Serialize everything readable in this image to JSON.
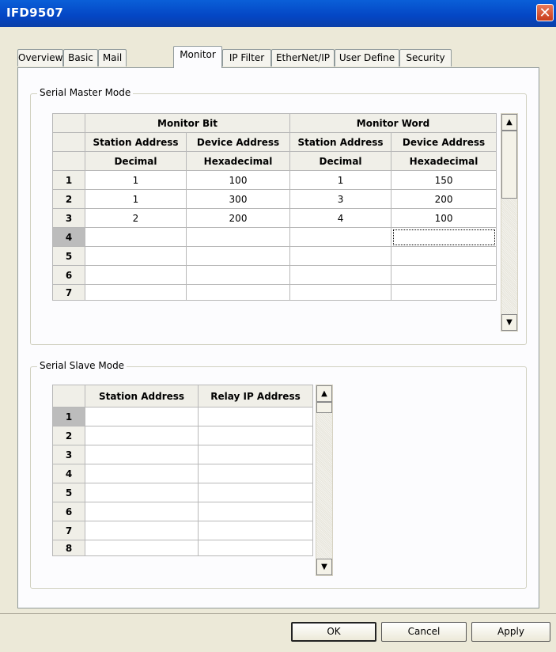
{
  "window": {
    "title": "IFD9507",
    "close_glyph": "✕"
  },
  "tabs": [
    {
      "label": "Overview"
    },
    {
      "label": "Basic"
    },
    {
      "label": "Mail"
    },
    {
      "label": "Monitor",
      "active": true
    },
    {
      "label": "IP Filter"
    },
    {
      "label": "EtherNet/IP"
    },
    {
      "label": "User Define"
    },
    {
      "label": "Security"
    }
  ],
  "master": {
    "group_label": "Serial Master Mode",
    "bit_header": "Monitor Bit",
    "word_header": "Monitor Word",
    "col_station": "Station Address",
    "col_device": "Device Address",
    "fmt_decimal": "Decimal",
    "fmt_hex": "Hexadecimal",
    "rows": [
      {
        "n": "1",
        "bit_station": "1",
        "bit_device": "100",
        "word_station": "1",
        "word_device": "150"
      },
      {
        "n": "2",
        "bit_station": "1",
        "bit_device": "300",
        "word_station": "3",
        "word_device": "200"
      },
      {
        "n": "3",
        "bit_station": "2",
        "bit_device": "200",
        "word_station": "4",
        "word_device": "100"
      },
      {
        "n": "4",
        "bit_station": "",
        "bit_device": "",
        "word_station": "",
        "word_device": ""
      },
      {
        "n": "5",
        "bit_station": "",
        "bit_device": "",
        "word_station": "",
        "word_device": ""
      },
      {
        "n": "6",
        "bit_station": "",
        "bit_device": "",
        "word_station": "",
        "word_device": ""
      },
      {
        "n": "7",
        "bit_station": "",
        "bit_device": "",
        "word_station": "",
        "word_device": ""
      }
    ],
    "selected_row": "4"
  },
  "slave": {
    "group_label": "Serial Slave Mode",
    "col_station": "Station Address",
    "col_relay": "Relay IP Address",
    "rows": [
      {
        "n": "1"
      },
      {
        "n": "2"
      },
      {
        "n": "3"
      },
      {
        "n": "4"
      },
      {
        "n": "5"
      },
      {
        "n": "6"
      },
      {
        "n": "7"
      },
      {
        "n": "8"
      }
    ],
    "selected_row": "1"
  },
  "scroll_glyphs": {
    "up": "▲",
    "down": "▼"
  },
  "buttons": {
    "ok": "OK",
    "cancel": "Cancel",
    "apply": "Apply"
  },
  "colors": {
    "titlebar": "#0446c4",
    "close": "#c83c1a",
    "window": "#ece9d8"
  }
}
